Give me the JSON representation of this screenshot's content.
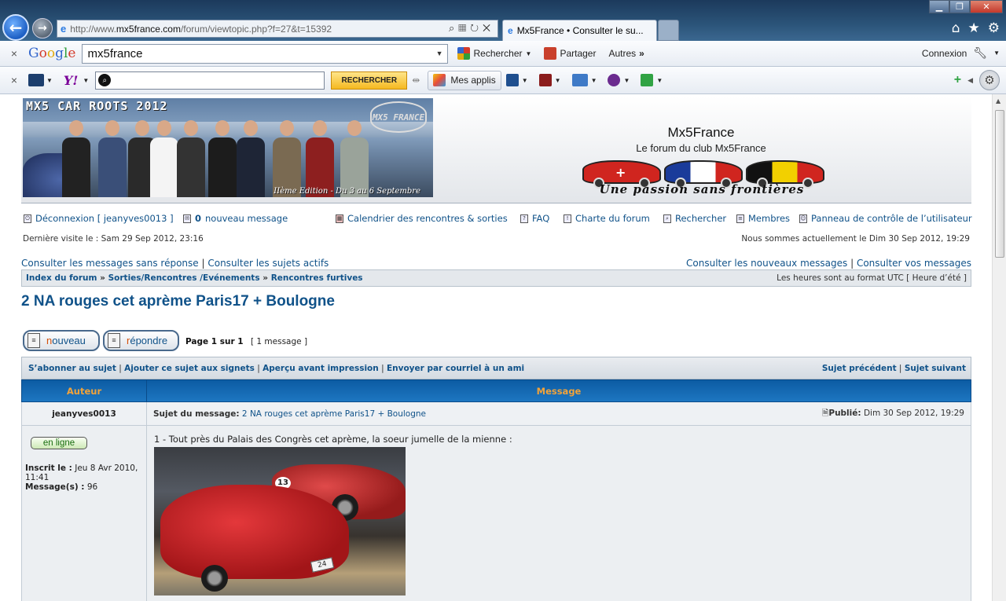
{
  "browser": {
    "url_prefix": "http://www.",
    "url_host": "mx5france.com",
    "url_path": "/forum/viewtopic.php?f=27&t=15392",
    "tab_title": "Mx5France • Consulter le su..."
  },
  "google_toolbar": {
    "logo": "Google",
    "search_value": "mx5france",
    "rechercher": "Rechercher",
    "partager": "Partager",
    "autres": "Autres",
    "connexion": "Connexion"
  },
  "yahoo_toolbar": {
    "search_value": "",
    "search_button": "RECHERCHER",
    "mes_applis": "Mes applis"
  },
  "forum": {
    "banner_title": "MX5 CAR ROOTS 2012",
    "banner_subtitle": "IIème Edition - Du 3 au 6 Septembre",
    "banner_logo": "MX5 FRANCE",
    "site_name": "Mx5France",
    "site_description": "Le forum du club Mx5France",
    "slogan": "Une passion sans frontières",
    "nav": {
      "logout": "Déconnexion [ jeanyves0013 ]",
      "new_messages_count": "0",
      "new_messages_label": "nouveau message",
      "calendar": "Calendrier des rencontres & sorties",
      "faq": "FAQ",
      "charter": "Charte du forum",
      "search": "Rechercher",
      "members": "Membres",
      "control_panel": "Panneau de contrôle de l’utilisateur"
    },
    "last_visit": "Dernière visite le : Sam 29 Sep 2012, 23:16",
    "now": "Nous sommes actuellement le Dim 30 Sep 2012, 19:29",
    "links_left_1": "Consulter les messages sans réponse",
    "links_left_2": "Consulter les sujets actifs",
    "links_right_1": "Consulter les nouveaux messages",
    "links_right_2": "Consulter vos messages",
    "breadcrumbs": [
      "Index du forum",
      "Sorties/Rencontres /Evénements",
      "Rencontres furtives"
    ],
    "timezone": "Les heures sont au format UTC [ Heure d’été ]",
    "topic_title": "2 NA rouges cet aprème Paris17 + Boulogne",
    "btn_nouveau_accent": "n",
    "btn_nouveau_rest": "ouveau",
    "btn_repondre_accent": "r",
    "btn_repondre_rest": "épondre",
    "page_label": "Page 1 sur 1",
    "message_count": "[ 1 message ]",
    "topic_actions": {
      "subscribe": "S’abonner au sujet",
      "bookmark": "Ajouter ce sujet aux signets",
      "print": "Aperçu avant impression",
      "email": "Envoyer par courriel à un ami",
      "prev": "Sujet précédent",
      "next": "Sujet suivant"
    },
    "table_headers": {
      "author": "Auteur",
      "message": "Message"
    },
    "post": {
      "author": "jeanyves0013",
      "subject_label": "Sujet du message:",
      "subject": "2 NA rouges cet aprème Paris17 + Boulogne",
      "published_label": "Publié:",
      "published": "Dim 30 Sep 2012, 19:29",
      "online": "en ligne",
      "joined_label": "Inscrit le :",
      "joined": "Jeu 8 Avr 2010, 11:41",
      "posts_label": "Message(s) :",
      "posts": "96",
      "body": "1 - Tout près du Palais des Congrès cet aprème, la soeur jumelle de la mienne :",
      "photo_race_number": "13",
      "photo_plate": "24"
    }
  }
}
